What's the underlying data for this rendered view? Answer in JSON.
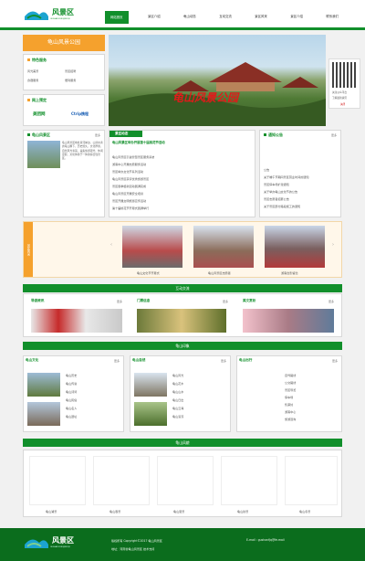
{
  "header": {
    "logo_text": "风景区",
    "logo_sub": "GUSHAN FENGJINGQU"
  },
  "nav": [
    "网站首页",
    "景区介绍",
    "龟山动态",
    "互动交流",
    "景区风采",
    "景区介绍",
    "联系我们"
  ],
  "sidebar": {
    "banner_text": "龟山风景公园",
    "service_title": "特色服务",
    "services": [
      "风光美景",
      "景区招聘",
      "食宿服务",
      "便利服务"
    ],
    "partner_title": "网上预定",
    "partners": [
      "美团网",
      "Ctrip携程"
    ]
  },
  "hero": {
    "overlay_text": "龟山风景公园"
  },
  "qr": {
    "caption1": "关注公众平台",
    "caption2": "了解最新资讯",
    "more": "关闭"
  },
  "intro": {
    "title": "龟山风景区",
    "more": "更多",
    "body": "龟山风景区地处黄河岸边、山清水秀的龟山脚下，历史悠久，文化厚重，自然风光秀丽，是集旅游观光、休闲度假、文化体验于一体的综合性景区。"
  },
  "news": {
    "title": "景区动态",
    "headline": "龟山风景区举办开展第十届桃花节活动",
    "items": [
      "龟山风景区引进智慧景区服务系统",
      "游客中心开展志愿服务活动",
      "景区举办文化节系列活动",
      "龟山风景区获评优秀旅游景区",
      "景区春季植树活动圆满完成",
      "龟山风景区开展安全培训",
      "景区开展文明旅游宣传活动",
      "第十届桃花节开幕式圆满举行"
    ]
  },
  "notice": {
    "title": "通知公告",
    "more": "更多",
    "items": [
      "公告",
      "关于端午节期间景区营业时间的通知",
      "景区停车场扩建通知",
      "关于举办龟山文化节的公告",
      "景区志愿者招募公告",
      "关于景区部分路段施工的通知"
    ]
  },
  "activity": {
    "title": "景区风采",
    "captions": [
      "龟山文化节开幕式",
      "龟山风景区志愿者",
      "游客合影留念"
    ]
  },
  "interact": {
    "title": "互动交流",
    "cols": [
      {
        "title": "导游资讯",
        "more": "更多"
      },
      {
        "title": "门票信息",
        "more": "更多"
      },
      {
        "title": "美文赏析",
        "more": "更多"
      }
    ]
  },
  "scenery_title": "龟山印象",
  "culture": {
    "title": "龟山文化",
    "more": "更多",
    "items": [
      "龟山历史",
      "龟山传说",
      "龟山诗词",
      "龟山民俗",
      "龟山名人",
      "龟山遗址"
    ]
  },
  "nature": {
    "title": "龟山自然",
    "more": "更多",
    "items": [
      "龟山风光",
      "龟山花木",
      "龟山山水",
      "龟山日出",
      "龟山云海",
      "龟山溪流"
    ]
  },
  "travel": {
    "title": "龟山出行",
    "more": "更多",
    "items": [
      "自驾路线",
      "公交路线",
      "景区导览",
      "停车场",
      "售票处",
      "游客中心",
      "旅游咨询"
    ]
  },
  "gallery": {
    "title": "龟山风貌",
    "captions": [
      "龟山湖景",
      "龟山春景",
      "龟山夏景",
      "龟山秋景",
      "龟山冬景"
    ]
  },
  "footer": {
    "copyright": "版权所有 Copyright©2017 龟山风景区",
    "contact": "E-mail : gushanfjq@fe.mail",
    "address": "地址：河南省龟山风景区 技术支持"
  }
}
